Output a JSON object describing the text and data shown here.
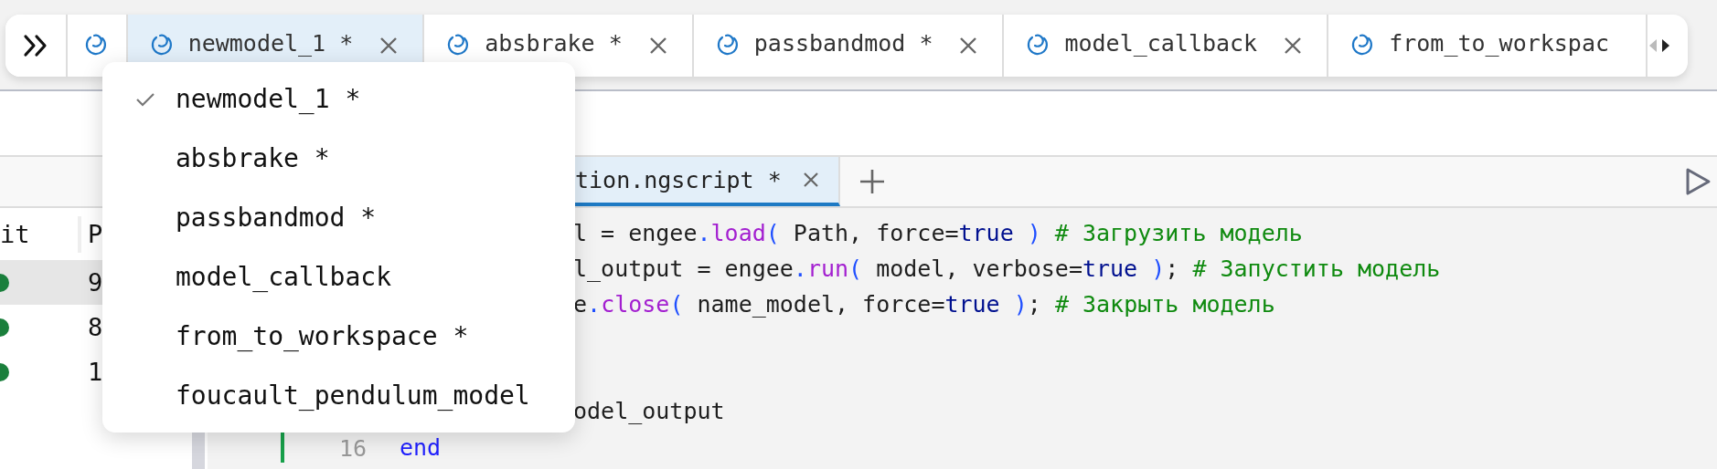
{
  "model_tabs": [
    {
      "kind": "partial",
      "selected": false,
      "closable": false
    },
    {
      "kind": "full",
      "label": "newmodel_1 *",
      "selected": true,
      "closable": true
    },
    {
      "kind": "full",
      "label": "absbrake *",
      "selected": false,
      "closable": true
    },
    {
      "kind": "full",
      "label": "passbandmod *",
      "selected": false,
      "closable": true
    },
    {
      "kind": "full",
      "label": "model_callback",
      "selected": false,
      "closable": true
    },
    {
      "kind": "full",
      "label": "from_to_workspac",
      "selected": false,
      "closable": false
    }
  ],
  "tab_menu": [
    {
      "label": "newmodel_1 *",
      "checked": true
    },
    {
      "label": "absbrake *",
      "checked": false
    },
    {
      "label": "passbandmod *",
      "checked": false
    },
    {
      "label": "model_callback",
      "checked": false
    },
    {
      "label": "from_to_workspace *",
      "checked": false
    },
    {
      "label": "foucault_pendulum_model",
      "checked": false
    }
  ],
  "left_table": {
    "columns": [
      "it",
      "P"
    ],
    "rows": [
      {
        "value": "9",
        "selected": true,
        "color": "#1a7f3c"
      },
      {
        "value": "8",
        "selected": false,
        "color": "#1a7f3c"
      },
      {
        "value": "1",
        "selected": false,
        "color": "#1a7f3c"
      }
    ]
  },
  "editor_tab": {
    "label": "tion.ngscript *",
    "selected": true
  },
  "code": [
    {
      "changed": false,
      "tokens": [
        {
          "text": "l = engee",
          "kind": "plain"
        },
        {
          "text": ".",
          "kind": "punct"
        },
        {
          "text": "load",
          "kind": "fn"
        },
        {
          "text": "(",
          "kind": "punct"
        },
        {
          "text": " Path, force=",
          "kind": "plain"
        },
        {
          "text": "true",
          "kind": "kw"
        },
        {
          "text": " )",
          "kind": "punct"
        },
        {
          "text": " # Загрузить модель",
          "kind": "comment"
        }
      ]
    },
    {
      "changed": false,
      "tokens": [
        {
          "text": "l_output = engee",
          "kind": "plain"
        },
        {
          "text": ".",
          "kind": "punct"
        },
        {
          "text": "run",
          "kind": "fn"
        },
        {
          "text": "(",
          "kind": "punct"
        },
        {
          "text": " model, verbose=",
          "kind": "plain"
        },
        {
          "text": "true",
          "kind": "kw"
        },
        {
          "text": " )",
          "kind": "punct"
        },
        {
          "text": ";",
          "kind": "plain"
        },
        {
          "text": " # Запустить модель",
          "kind": "comment"
        }
      ]
    },
    {
      "changed": false,
      "tokens": [
        {
          "text": "e",
          "kind": "plain"
        },
        {
          "text": ".",
          "kind": "punct"
        },
        {
          "text": "close",
          "kind": "fn"
        },
        {
          "text": "(",
          "kind": "punct"
        },
        {
          "text": " name_model, force=",
          "kind": "plain"
        },
        {
          "text": "true",
          "kind": "kw"
        },
        {
          "text": " )",
          "kind": "punct"
        },
        {
          "text": ";",
          "kind": "plain"
        },
        {
          "text": " # Закрыть модель",
          "kind": "comment"
        }
      ]
    },
    {
      "changed": false,
      "tokens": [
        {
          "text": "odel_output",
          "kind": "plain"
        }
      ]
    },
    {
      "number": "16",
      "changed": true,
      "tokens": [
        {
          "text": "end",
          "kind": "end"
        }
      ]
    }
  ]
}
